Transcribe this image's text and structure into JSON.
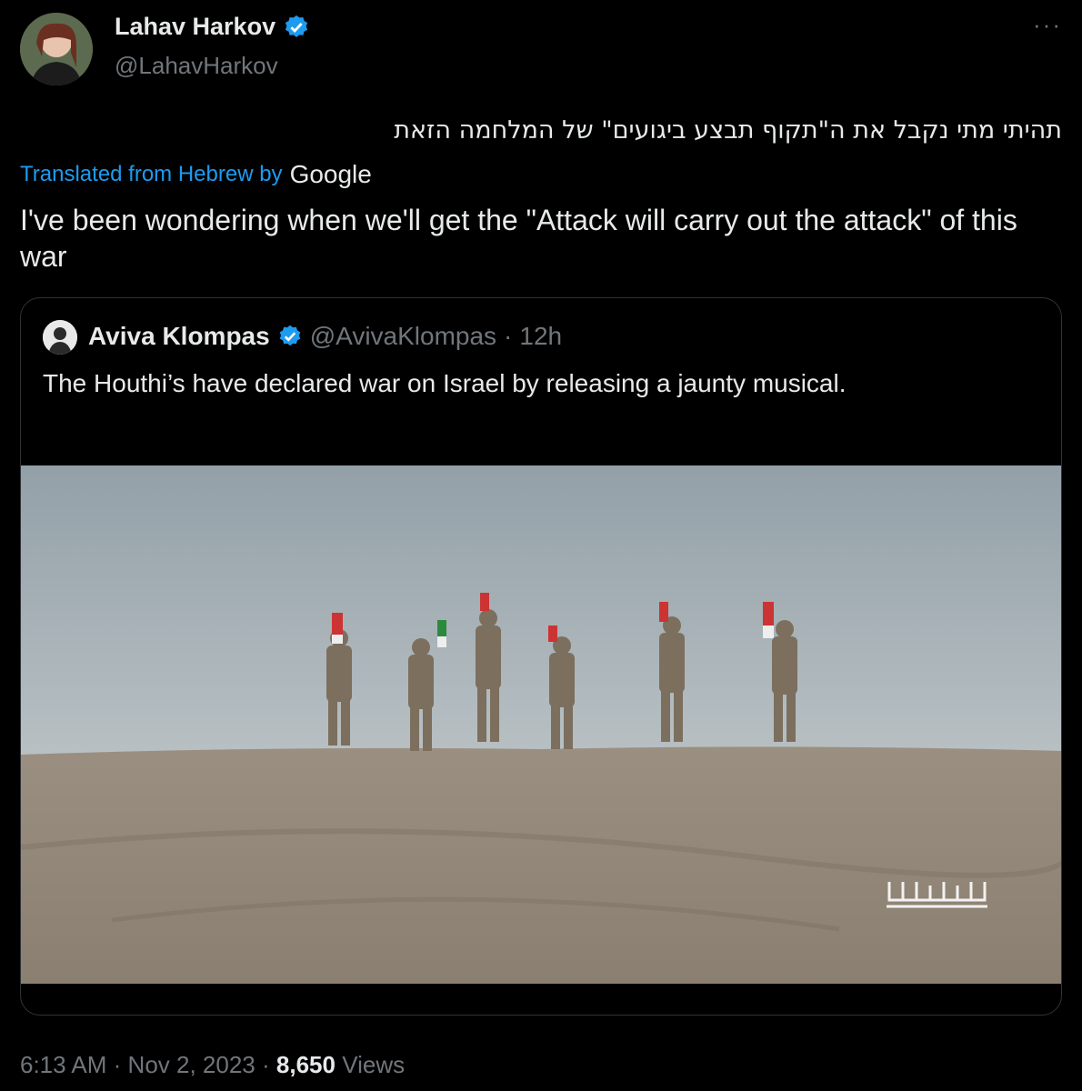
{
  "author": {
    "name": "Lahav Harkov",
    "handle": "@LahavHarkov"
  },
  "more_label": "···",
  "tweet": {
    "original_text": "תהיתי מתי נקבל את ה\"תקוף תבצע ביגועים\" של המלחמה הזאת",
    "translated_from": "Translated from Hebrew by",
    "translator": "Google",
    "translation": "I've been wondering when we'll get the \"Attack will carry out the attack\" of this war"
  },
  "quote": {
    "name": "Aviva Klompas",
    "handle": "@AvivaKlompas",
    "separator": "·",
    "time": "12h",
    "text": "The Houthi’s have declared war on Israel by releasing a jaunty musical."
  },
  "footer": {
    "time": "6:13 AM",
    "sep1": "·",
    "date": "Nov 2, 2023",
    "sep2": "·",
    "views_count": "8,650",
    "views_label": "Views"
  },
  "colors": {
    "background": "#000000",
    "text": "#e7e9ea",
    "muted": "#71767b",
    "link": "#1d9bf0",
    "verified": "#1d9bf0"
  },
  "icons": [
    "verified-badge-icon",
    "more-icon"
  ]
}
